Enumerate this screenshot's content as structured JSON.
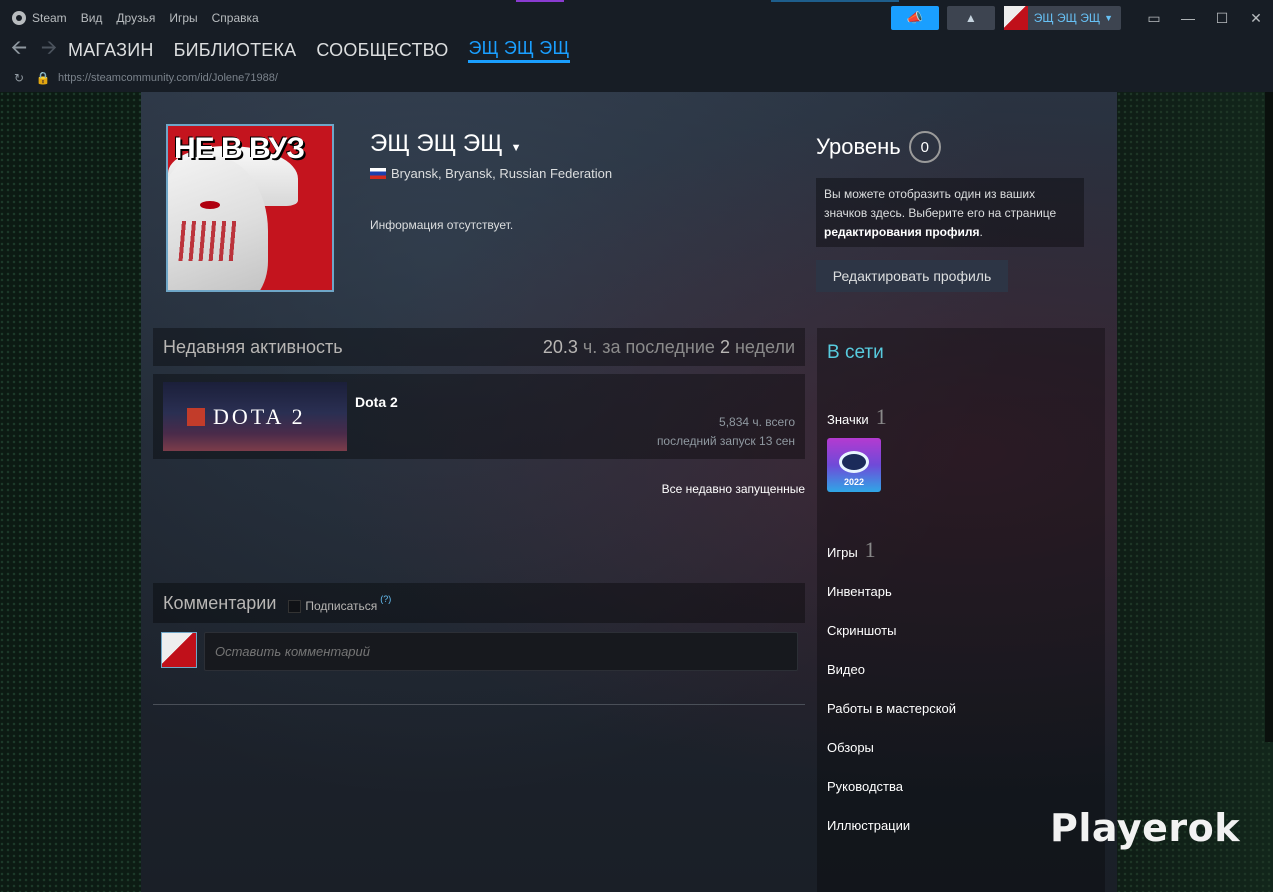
{
  "menu": [
    "Steam",
    "Вид",
    "Друзья",
    "Игры",
    "Справка"
  ],
  "account": {
    "name": "ЭЩ ЭЩ ЭЩ"
  },
  "nav": {
    "links": [
      "МАГАЗИН",
      "БИБЛИОТЕКА",
      "СООБЩЕСТВО",
      "ЭЩ ЭЩ ЭЩ"
    ],
    "active_index": 3
  },
  "url": "https://steamcommunity.com/id/Jolene71988/",
  "profile": {
    "avatar_text": "НЕ В ВУЗ",
    "name": "ЭЩ ЭЩ ЭЩ",
    "location": "Bryansk, Bryansk, Russian Federation",
    "summary": "Информация отсутствует.",
    "level_label": "Уровень",
    "level": "0",
    "badge_hint_pre": "Вы можете отобразить один из ваших значков здесь. Выберите его на странице ",
    "badge_hint_link": "редактирования профиля",
    "badge_hint_post": ".",
    "edit_button": "Редактировать профиль"
  },
  "recent_activity": {
    "title": "Недавняя активность",
    "hours_value": "20.3",
    "hours_mid": "ч. за последние",
    "hours_weeks": "2",
    "hours_end": "недели",
    "games": [
      {
        "name": "Dota 2",
        "capsule_text": "DOTA 2",
        "total": "5,834 ч. всего",
        "last_played": "последний запуск 13 сен"
      }
    ],
    "all_link": "Все недавно запущенные"
  },
  "comments": {
    "title": "Комментарии",
    "subscribe_label": "Подписаться",
    "help": "(?)",
    "placeholder": "Оставить комментарий"
  },
  "sidebar": {
    "status": "В сети",
    "badges_label": "Значки",
    "badges_count": "1",
    "badge_year": "2022",
    "games_label": "Игры",
    "games_count": "1",
    "links": [
      "Инвентарь",
      "Скриншоты",
      "Видео",
      "Работы в мастерской",
      "Обзоры",
      "Руководства",
      "Иллюстрации"
    ]
  },
  "watermark": "Playerok",
  "colors": {
    "accent": "#1a9fff",
    "online": "#57cbde",
    "titlebar": "#171d25"
  }
}
